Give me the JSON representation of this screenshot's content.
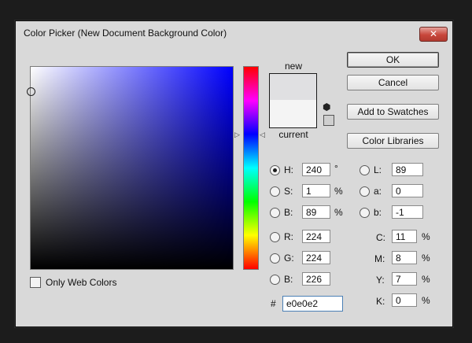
{
  "window": {
    "title": "Color Picker (New Document Background Color)",
    "close_label": "✕"
  },
  "preview": {
    "new_label": "new",
    "current_label": "current",
    "new_color": "#e0e0e2",
    "current_color": "#f4f4f4"
  },
  "buttons": {
    "ok": "OK",
    "cancel": "Cancel",
    "add_to_swatches": "Add to Swatches",
    "color_libraries": "Color Libraries"
  },
  "hsb": [
    {
      "label": "H:",
      "value": "240",
      "unit": "°",
      "selected": true
    },
    {
      "label": "S:",
      "value": "1",
      "unit": "%",
      "selected": false
    },
    {
      "label": "B:",
      "value": "89",
      "unit": "%",
      "selected": false
    }
  ],
  "rgb": [
    {
      "label": "R:",
      "value": "224"
    },
    {
      "label": "G:",
      "value": "224"
    },
    {
      "label": "B:",
      "value": "226"
    }
  ],
  "lab": [
    {
      "label": "L:",
      "value": "89"
    },
    {
      "label": "a:",
      "value": "0"
    },
    {
      "label": "b:",
      "value": "-1"
    }
  ],
  "cmyk": [
    {
      "label": "C:",
      "value": "11",
      "unit": "%"
    },
    {
      "label": "M:",
      "value": "8",
      "unit": "%"
    },
    {
      "label": "Y:",
      "value": "7",
      "unit": "%"
    },
    {
      "label": "K:",
      "value": "0",
      "unit": "%"
    }
  ],
  "hex": {
    "prefix": "#",
    "value": "e0e0e2"
  },
  "only_web_colors": {
    "label": "Only Web Colors",
    "checked": false
  },
  "icons": {
    "cube": "out-of-gamut-cube-icon"
  }
}
